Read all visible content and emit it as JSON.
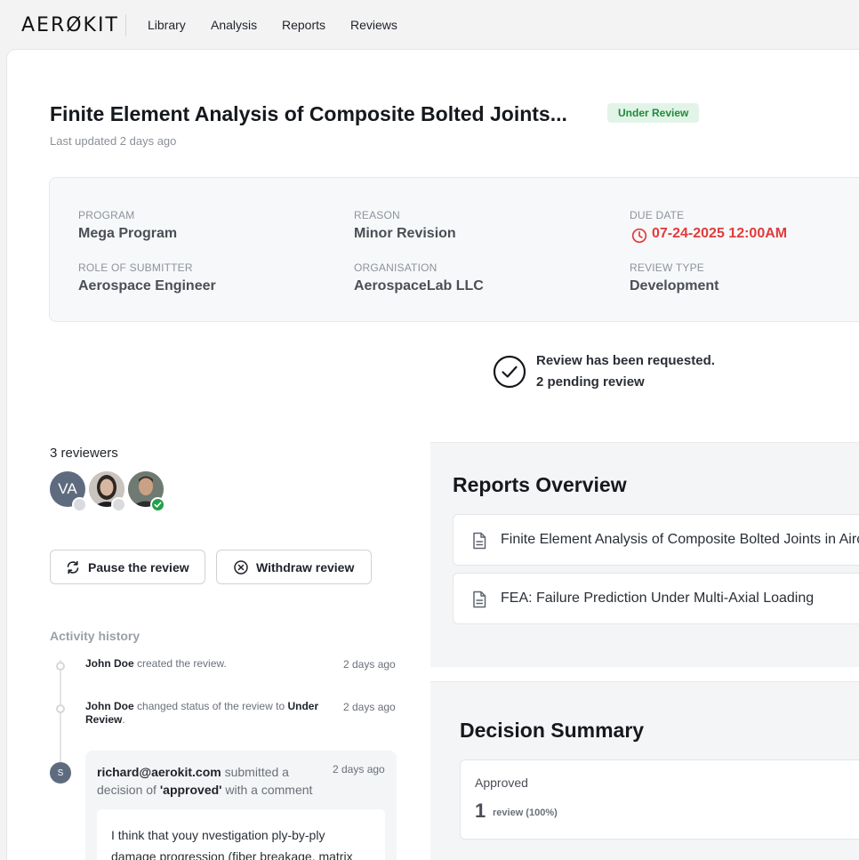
{
  "app": {
    "logo": "AERØKIT"
  },
  "nav": {
    "items": [
      {
        "label": "Library"
      },
      {
        "label": "Analysis"
      },
      {
        "label": "Reports"
      },
      {
        "label": "Reviews"
      }
    ]
  },
  "review": {
    "title": "Finite Element Analysis of Composite Bolted Joints...",
    "status": "Under Review",
    "last_updated": "Last updated 2 days ago",
    "status_color": "#1f8a3b"
  },
  "info": {
    "program": {
      "label": "PROGRAM",
      "value": "Mega Program"
    },
    "reason": {
      "label": "REASON",
      "value": "Minor Revision"
    },
    "due_date": {
      "label": "DUE DATE",
      "value": "07-24-2025 12:00AM",
      "color": "#e03b3b"
    },
    "role": {
      "label": "ROLE OF SUBMITTER",
      "value": "Aerospace Engineer"
    },
    "organisation": {
      "label": "ORGANISATION",
      "value": "AerospaceLab LLC"
    },
    "review_type": {
      "label": "REVIEW TYPE",
      "value": "Development"
    }
  },
  "request": {
    "line1": "Review has been requested.",
    "line2": "2 pending review"
  },
  "reviewers": {
    "title": "3 reviewers",
    "list": [
      {
        "initials": "VA",
        "status": "pending"
      },
      {
        "icon": "person-photo-woman",
        "status": "pending"
      },
      {
        "icon": "person-photo-man",
        "status": "approved"
      }
    ]
  },
  "actions": {
    "pause": "Pause the review",
    "withdraw": "Withdraw review"
  },
  "activity": {
    "title": "Activity history",
    "entries": [
      {
        "user": "John Doe",
        "text": "created the review.",
        "time": "2 days ago"
      },
      {
        "user": "John Doe",
        "text": "changed status of the review to",
        "status": "Under Review",
        "tail": ".",
        "time": "2 days ago"
      },
      {
        "avatar": "S",
        "user": "richard@aerokit.com",
        "text": "submitted a decision of",
        "decision": "'approved'",
        "tail": "with a comment",
        "time": "2 days ago",
        "comment": "I think that youy nvestigation ply-by-ply damage progression (fiber breakage, matrix"
      }
    ]
  },
  "reports": {
    "title": "Reports Overview",
    "items": [
      {
        "name": "Finite Element Analysis of Composite Bolted Joints in Aircraft"
      },
      {
        "name": "FEA: Failure Prediction Under Multi-Axial Loading"
      }
    ]
  },
  "decision": {
    "title": "Decision Summary",
    "label": "Approved",
    "count": "1",
    "sub": "review (100%)"
  }
}
